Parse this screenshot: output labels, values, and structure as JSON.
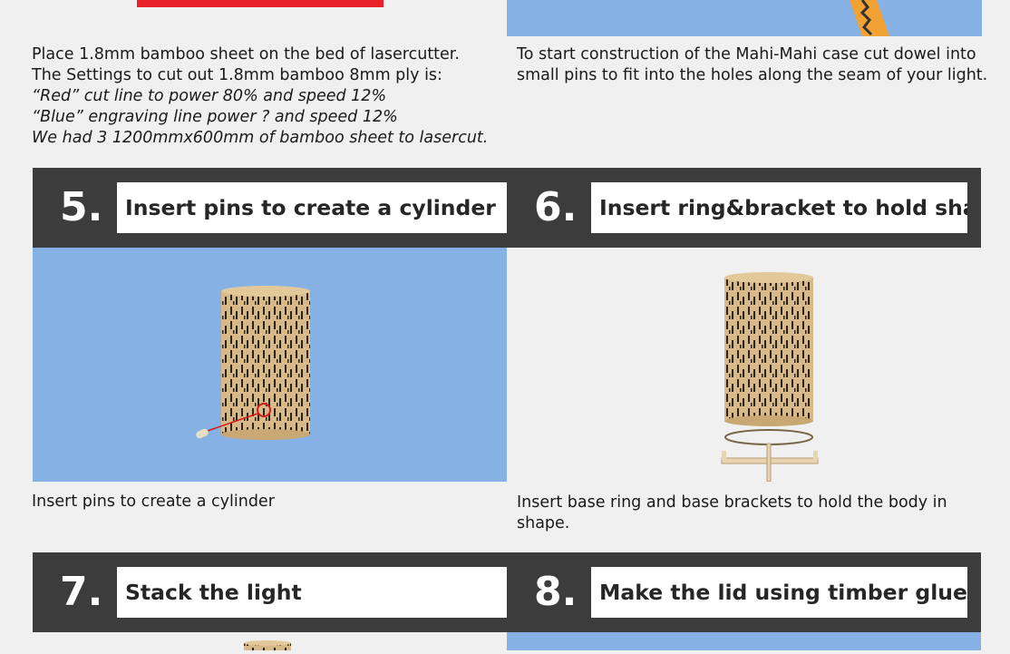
{
  "colors": {
    "background": "#f0f0f0",
    "band": "#3c3c3c",
    "panel_blue": "#86b1e4",
    "laser_red": "#e8202a"
  },
  "step3": {
    "caption_lines": [
      "Place 1.8mm bamboo sheet on the bed of lasercutter.",
      "The Settings to cut  out 1.8mm bamboo 8mm ply is:"
    ],
    "settings_lines": [
      "“Red” cut line to power 80% and speed 12%",
      "“Blue” engraving line power ? and speed 12%",
      "We had 3 1200mmx600mm of bamboo sheet to lasercut."
    ]
  },
  "step4": {
    "caption_lines": [
      "To start construction of the Mahi-Mahi case cut dowel into",
      "small pins to fit into the holes along the seam of your light."
    ]
  },
  "steps": [
    {
      "number": "5.",
      "title": "Insert pins to create a cylinder",
      "caption_lines": [
        "Insert pins to create a cylinder"
      ]
    },
    {
      "number": "6.",
      "title": "Insert ring&bracket to hold shape",
      "caption_lines": [
        "Insert base ring and base brackets to hold the body in",
        "shape."
      ]
    },
    {
      "number": "7.",
      "title": "Stack the light"
    },
    {
      "number": "8.",
      "title": "Make the lid using timber glue"
    }
  ]
}
